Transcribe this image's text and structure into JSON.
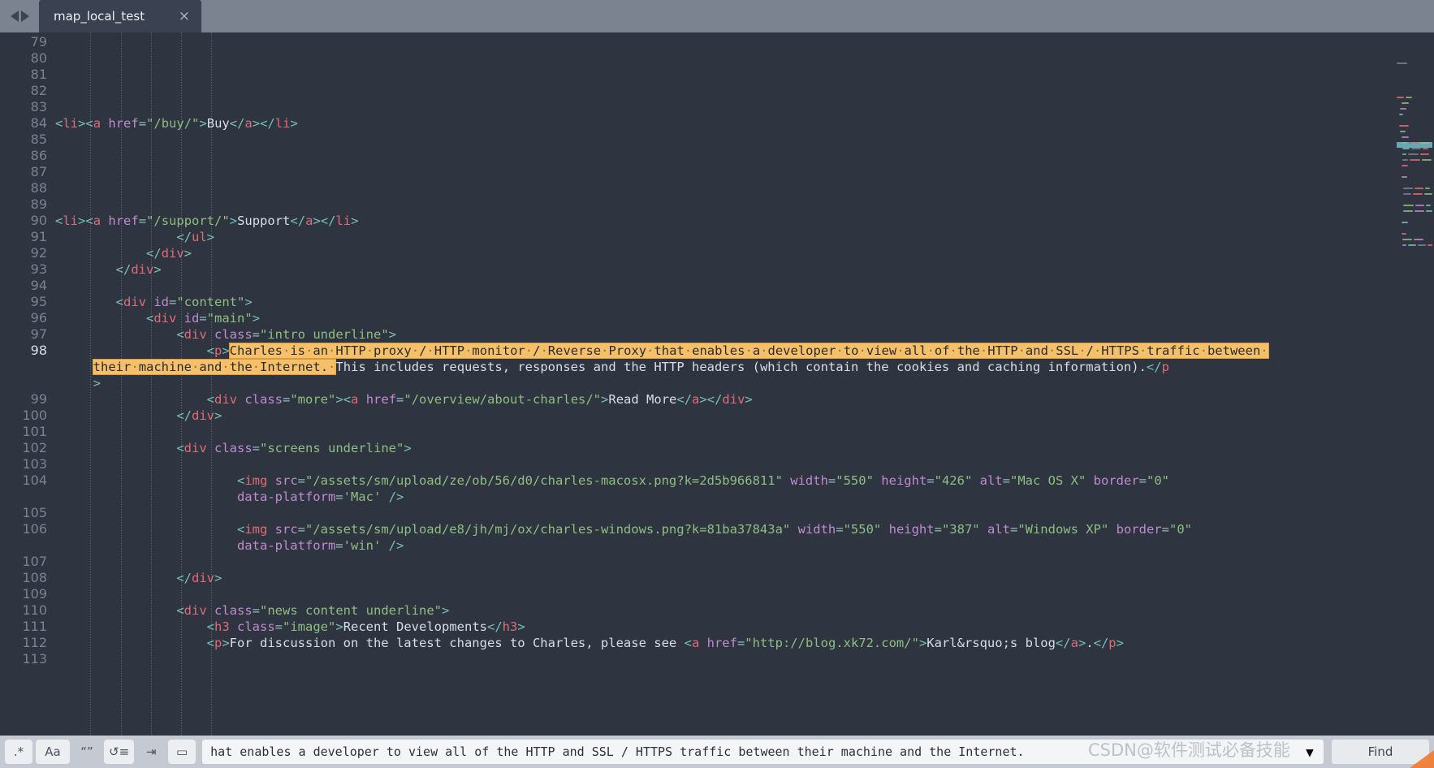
{
  "window": {
    "tab_title": "map_local_test",
    "close_glyph": "×",
    "nav_back": "◀",
    "nav_forward": "▶"
  },
  "editor": {
    "first_line_number": 79,
    "current_line": 98,
    "line_numbers": [
      79,
      80,
      81,
      82,
      83,
      84,
      85,
      86,
      87,
      88,
      89,
      90,
      91,
      92,
      93,
      94,
      95,
      96,
      97,
      98,
      99,
      100,
      101,
      102,
      103,
      104,
      105,
      106,
      107,
      108,
      109,
      110,
      111,
      112,
      113
    ],
    "lines": [
      {
        "num": 79,
        "text": ""
      },
      {
        "num": 80,
        "text": ""
      },
      {
        "num": 81,
        "text": ""
      },
      {
        "num": 82,
        "text": ""
      },
      {
        "num": 83,
        "text": ""
      },
      {
        "num": 84,
        "text": "<li><a href=\"/buy/\">Buy</a></li>"
      },
      {
        "num": 85,
        "text": ""
      },
      {
        "num": 86,
        "text": ""
      },
      {
        "num": 87,
        "text": ""
      },
      {
        "num": 88,
        "text": ""
      },
      {
        "num": 89,
        "text": ""
      },
      {
        "num": 90,
        "text": "<li><a href=\"/support/\">Support</a></li>"
      },
      {
        "num": 91,
        "text": "                </ul>"
      },
      {
        "num": 92,
        "text": "            </div>"
      },
      {
        "num": 93,
        "text": "        </div>"
      },
      {
        "num": 94,
        "text": ""
      },
      {
        "num": 95,
        "text": "        <div id=\"content\">"
      },
      {
        "num": 96,
        "text": "            <div id=\"main\">"
      },
      {
        "num": 97,
        "text": "                <div class=\"intro underline\">"
      },
      {
        "num": 98,
        "text": "                    <p>Charles is an HTTP proxy / HTTP monitor / Reverse Proxy that enables a developer to view all of the HTTP and SSL / HTTPS traffic between their machine and the Internet. This includes requests, responses and the HTTP headers (which contain the cookies and caching information).</p>"
      },
      {
        "num": 99,
        "text": "                    <div class=\"more\"><a href=\"/overview/about-charles/\">Read More</a></div>"
      },
      {
        "num": 100,
        "text": "                </div>"
      },
      {
        "num": 101,
        "text": ""
      },
      {
        "num": 102,
        "text": "                <div class=\"screens underline\">"
      },
      {
        "num": 103,
        "text": ""
      },
      {
        "num": 104,
        "text": "                        <img src=\"/assets/sm/upload/ze/ob/56/d0/charles-macosx.png?k=2d5b966811\" width=\"550\" height=\"426\" alt=\"Mac OS X\" border=\"0\" data-platform='Mac' />"
      },
      {
        "num": 105,
        "text": ""
      },
      {
        "num": 106,
        "text": "                        <img src=\"/assets/sm/upload/e8/jh/mj/ox/charles-windows.png?k=81ba37843a\" width=\"550\" height=\"387\" alt=\"Windows XP\" border=\"0\" data-platform='win' />"
      },
      {
        "num": 107,
        "text": ""
      },
      {
        "num": 108,
        "text": "                </div>"
      },
      {
        "num": 109,
        "text": ""
      },
      {
        "num": 110,
        "text": "                <div class=\"news content underline\">"
      },
      {
        "num": 111,
        "text": "                    <h3 class=\"image\">Recent Developments</h3>"
      },
      {
        "num": 112,
        "text": "                    <p>For discussion on the latest changes to Charles, please see <a href=\"http://blog.xk72.com/\">Karl&rsquo;s blog</a>.</p>"
      },
      {
        "num": 113,
        "text": ""
      }
    ],
    "selection": {
      "part1": "Charles is an HTTP proxy / HTTP monitor / Reverse Proxy that enables a developer to view all of the HTTP and SSL / HTTPS traffic between ",
      "part2": "their machine and the Internet. ",
      "trailing": "This includes requests, responses and the HTTP headers (which contain the cookies and caching information).",
      "highlight_color": "#f5c06a",
      "caret_color": "#f0b43a"
    },
    "colors": {
      "background": "#2e3440",
      "gutter_text": "#7a8394",
      "current_line_gutter": "#4a5263",
      "tag": "#e06c75",
      "attribute": "#c08bd0",
      "string": "#8fbf7f",
      "punctuation": "#78c0b0",
      "text": "#d8dee9"
    }
  },
  "findbar": {
    "regex_label": ".*",
    "match_case_label": "Aa",
    "whole_word_label": "“”",
    "wrap_label": "↺≡",
    "in_selection_label": "⇥",
    "highlight_label": "▭",
    "search_value": "hat enables a developer to view all of the HTTP and SSL / HTTPS traffic between their machine and the Internet.",
    "search_placeholder": "Find",
    "dropdown_glyph": "▼",
    "find_button_label": "Find",
    "watermark": "CSDN@软件测试必备技能"
  }
}
